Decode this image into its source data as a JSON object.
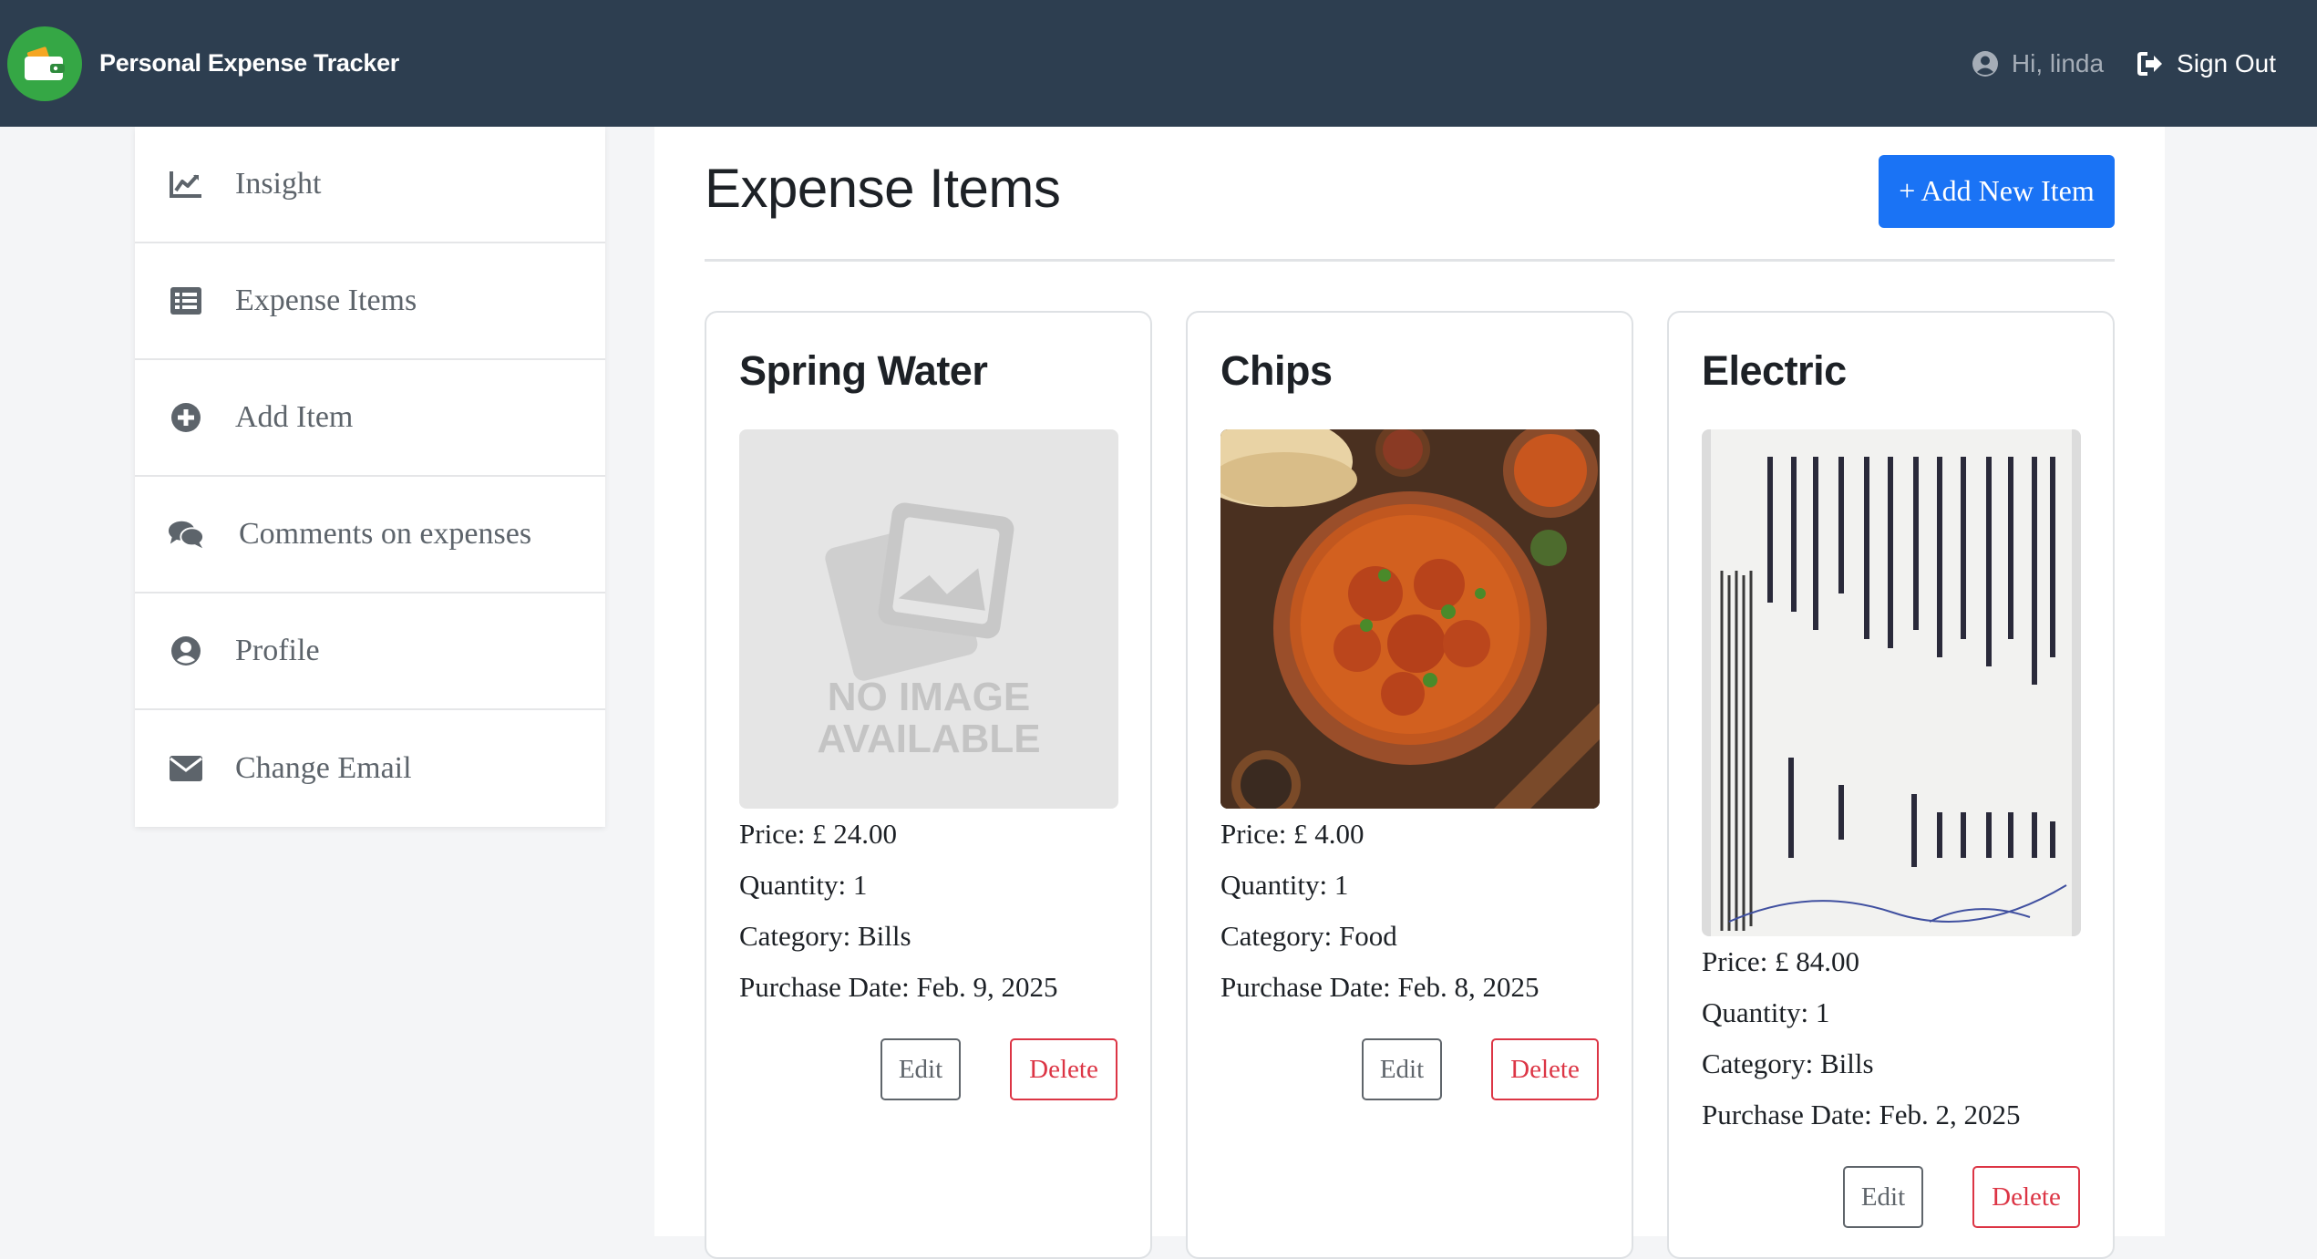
{
  "app": {
    "brand": "Personal Expense Tracker",
    "greeting": "Hi, linda",
    "sign_out": "Sign Out"
  },
  "sidebar": {
    "items": [
      {
        "label": "Insight",
        "icon": "chart-line-icon"
      },
      {
        "label": "Expense Items",
        "icon": "list-icon"
      },
      {
        "label": "Add Item",
        "icon": "plus-circle-icon"
      },
      {
        "label": "Comments on expenses",
        "icon": "comments-icon"
      },
      {
        "label": "Profile",
        "icon": "user-circle-icon"
      },
      {
        "label": "Change Email",
        "icon": "envelope-icon"
      }
    ]
  },
  "main": {
    "title": "Expense Items",
    "add_button": "+ Add New Item"
  },
  "cards": [
    {
      "title": "Spring Water",
      "image": "no-image-placeholder",
      "no_image_line1": "NO IMAGE",
      "no_image_line2": "AVAILABLE",
      "price": "Price: £ 24.00",
      "quantity": "Quantity: 1",
      "category": "Category: Bills",
      "purchase_date": "Purchase Date: Feb. 9, 2025",
      "edit": "Edit",
      "delete": "Delete"
    },
    {
      "title": "Chips",
      "image": "curry-dish-photo",
      "price": "Price: £ 4.00",
      "quantity": "Quantity: 1",
      "category": "Category: Food",
      "purchase_date": "Purchase Date: Feb. 8, 2025",
      "edit": "Edit",
      "delete": "Delete"
    },
    {
      "title": "Electric",
      "image": "receipt-photo",
      "price": "Price: £ 84.00",
      "quantity": "Quantity: 1",
      "category": "Category: Bills",
      "purchase_date": "Purchase Date: Feb. 2, 2025",
      "edit": "Edit",
      "delete": "Delete"
    }
  ],
  "colors": {
    "navbar": "#2d3e50",
    "brand_green": "#35a745",
    "primary": "#1a73f5",
    "danger": "#dc3545"
  }
}
